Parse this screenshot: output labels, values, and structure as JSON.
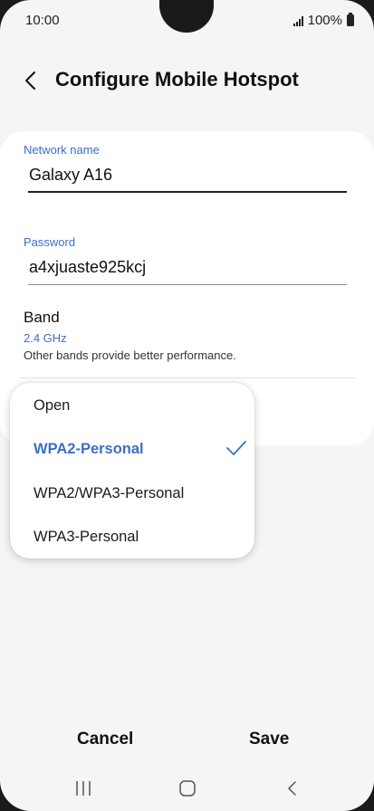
{
  "status_bar": {
    "time": "10:00",
    "battery": "100%"
  },
  "header": {
    "title": "Configure Mobile Hotspot",
    "back_icon": "chevron-left-icon"
  },
  "form": {
    "network_name_label": "Network name",
    "network_name_value": "Galaxy A16",
    "password_label": "Password",
    "password_value": "a4xjuaste925kcj",
    "band_label": "Band",
    "band_value": "2.4 GHz",
    "band_description": "Other bands provide better performance."
  },
  "security_dropdown": {
    "options": [
      "Open",
      "WPA2-Personal",
      "WPA2/WPA3-Personal",
      "WPA3-Personal"
    ],
    "selected": "WPA2-Personal",
    "selected_color": "#3b6fc4"
  },
  "actions": {
    "cancel": "Cancel",
    "save": "Save"
  },
  "nav_bar": {
    "recents_icon": "recents-icon",
    "home_icon": "home-icon",
    "back_icon": "back-icon"
  },
  "colors": {
    "accent": "#3b6fc4",
    "background": "#f5f5f7",
    "card": "#ffffff"
  }
}
